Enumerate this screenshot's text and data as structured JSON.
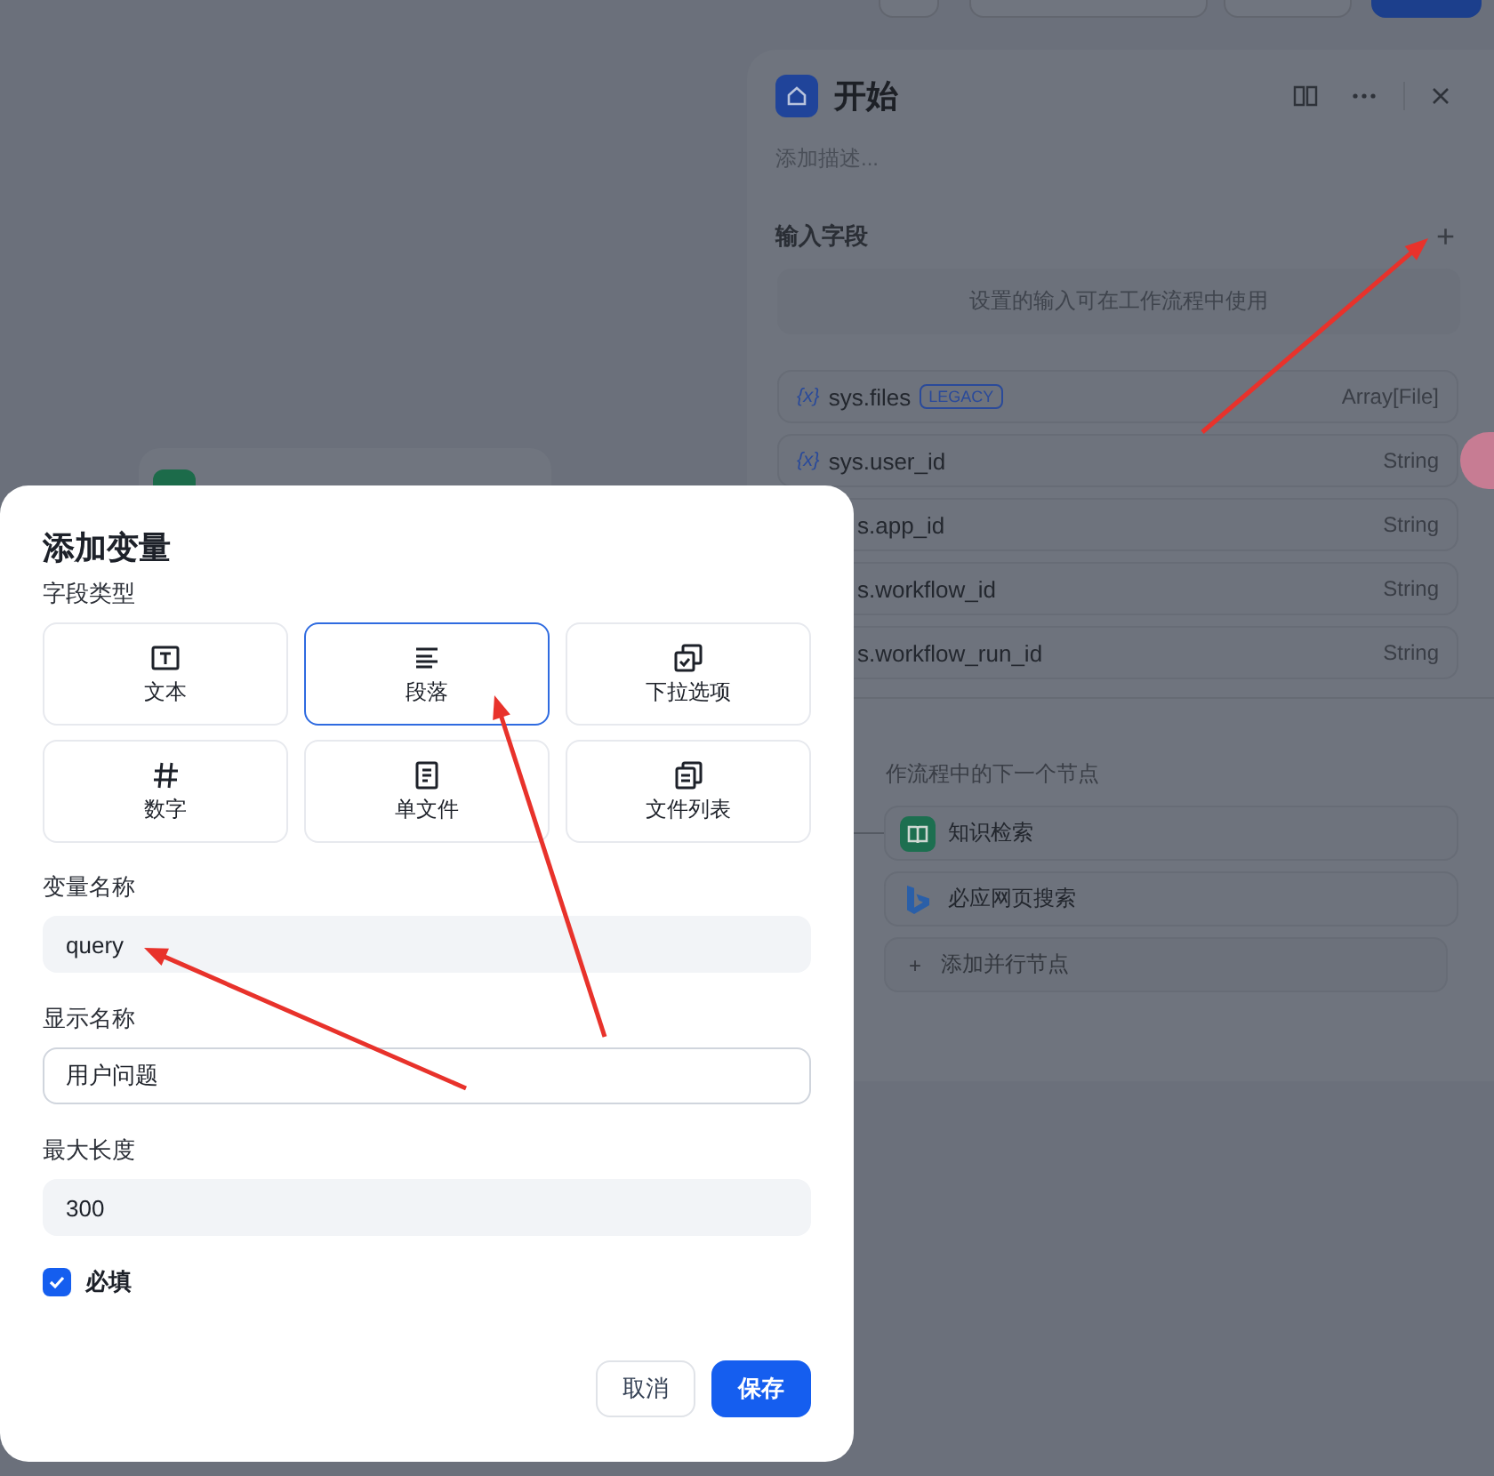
{
  "panel": {
    "title": "开始",
    "description_placeholder": "添加描述...",
    "input_fields": {
      "heading": "输入字段",
      "add_icon": "+",
      "hint": "设置的输入可在工作流程中使用",
      "variables": [
        {
          "icon": "{x}",
          "name": "sys.files",
          "badge": "LEGACY",
          "type": "Array[File]"
        },
        {
          "icon": "{x}",
          "name": "sys.user_id",
          "type": "String"
        },
        {
          "name": "s.app_id",
          "type": "String"
        },
        {
          "name": "s.workflow_id",
          "type": "String"
        },
        {
          "name": "s.workflow_run_id",
          "type": "String"
        }
      ]
    },
    "next_step": {
      "heading": "作流程中的下一个节点",
      "nodes": [
        {
          "kind": "knowledge",
          "label": "知识检索"
        },
        {
          "kind": "bing",
          "label": "必应网页搜索"
        },
        {
          "kind": "add",
          "icon": "+",
          "label": "添加并行节点"
        }
      ]
    }
  },
  "dialog": {
    "title": "添加变量",
    "field_type_label": "字段类型",
    "field_types": [
      {
        "kind": "text",
        "label": "文本",
        "selected": false
      },
      {
        "kind": "paragraph",
        "label": "段落",
        "selected": true
      },
      {
        "kind": "select",
        "label": "下拉选项",
        "selected": false
      },
      {
        "kind": "number",
        "label": "数字",
        "selected": false
      },
      {
        "kind": "file",
        "label": "单文件",
        "selected": false
      },
      {
        "kind": "file-list",
        "label": "文件列表",
        "selected": false
      }
    ],
    "fields": [
      {
        "label": "变量名称",
        "value": "query",
        "focused": false
      },
      {
        "label": "显示名称",
        "value": "用户问题",
        "focused": true
      },
      {
        "label": "最大长度",
        "value": "300",
        "focused": false
      }
    ],
    "required": {
      "label": "必填",
      "checked": true
    },
    "buttons": [
      {
        "kind": "secondary",
        "label": "取消"
      },
      {
        "kind": "primary",
        "label": "保存"
      }
    ]
  }
}
